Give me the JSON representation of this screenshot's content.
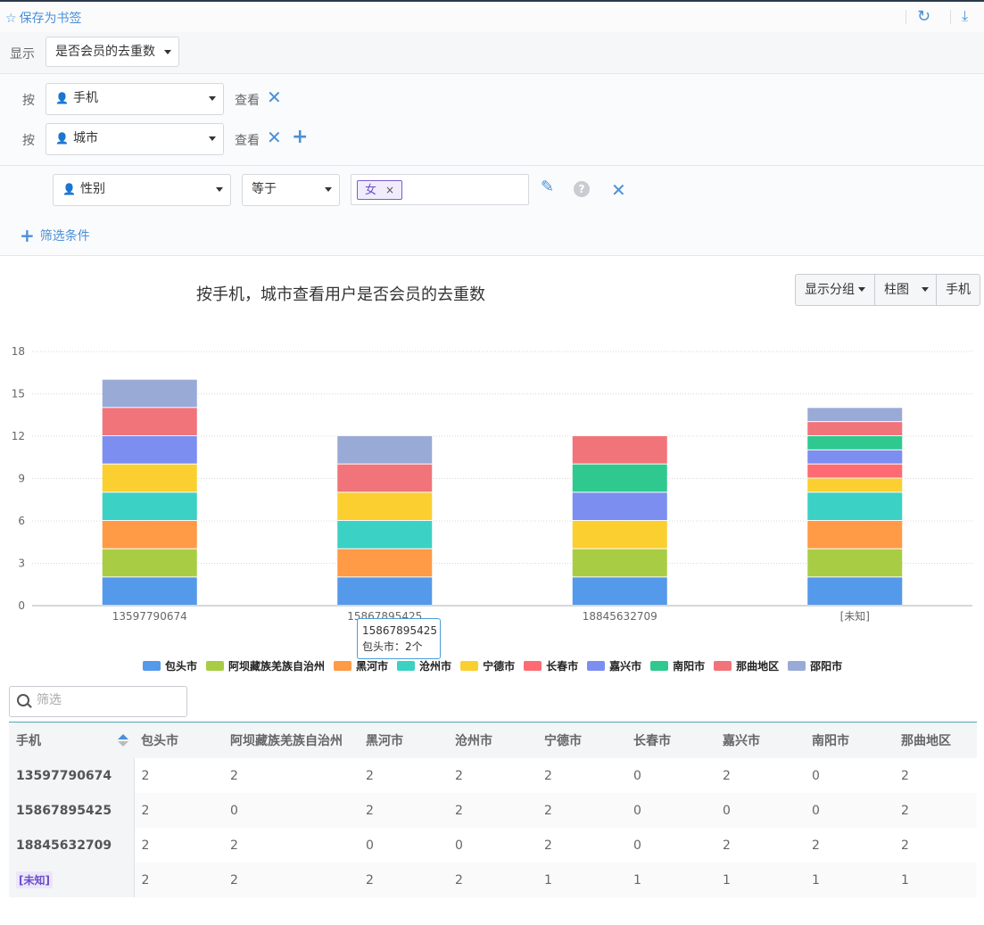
{
  "topbar": {
    "bookmark_label": "保存为书签",
    "star_icon": "star-outline-icon",
    "refresh_icon": "refresh-icon",
    "download_icon": "download-icon"
  },
  "show": {
    "label": "显示",
    "metric": "是否会员的去重数"
  },
  "groupby": {
    "by_label": "按",
    "view_label": "查看",
    "rows": [
      {
        "field": "手机"
      },
      {
        "field": "城市"
      }
    ]
  },
  "filter": {
    "field": "性别",
    "operator": "等于",
    "tag": "女",
    "tag_close": "×",
    "help": "?",
    "add_label": "筛选条件"
  },
  "chart_header": {
    "title": "按手机，城市查看用户是否会员的去重数",
    "buttons": [
      "显示分组",
      "柱图",
      "手机"
    ]
  },
  "tooltip": {
    "title": "15867895425",
    "line": "包头市：2个"
  },
  "chart_data": {
    "type": "bar",
    "stacked": true,
    "categories": [
      "13597790674",
      "15867895425",
      "18845632709",
      "[未知]"
    ],
    "ylim": [
      0,
      18
    ],
    "yticks": [
      0,
      3,
      6,
      9,
      12,
      15,
      18
    ],
    "grid": true,
    "legend": "bottom",
    "series": [
      {
        "name": "包头市",
        "color": "#5599ea",
        "values": [
          2,
          2,
          2,
          2
        ]
      },
      {
        "name": "阿坝藏族羌族自治州",
        "color": "#a8cd44",
        "values": [
          2,
          0,
          2,
          2
        ]
      },
      {
        "name": "黑河市",
        "color": "#ff9a46",
        "values": [
          2,
          2,
          0,
          2
        ]
      },
      {
        "name": "沧州市",
        "color": "#3bd1c4",
        "values": [
          2,
          2,
          0,
          2
        ]
      },
      {
        "name": "宁德市",
        "color": "#fbcf2f",
        "values": [
          2,
          2,
          2,
          1
        ]
      },
      {
        "name": "长春市",
        "color": "#ff6b72",
        "values": [
          0,
          0,
          0,
          1
        ]
      },
      {
        "name": "嘉兴市",
        "color": "#7c8ef0",
        "values": [
          2,
          0,
          2,
          1
        ]
      },
      {
        "name": "南阳市",
        "color": "#2fc990",
        "values": [
          0,
          0,
          2,
          1
        ]
      },
      {
        "name": "那曲地区",
        "color": "#f0747a",
        "values": [
          2,
          2,
          2,
          1
        ]
      },
      {
        "name": "邵阳市",
        "color": "#99aad6",
        "values": [
          2,
          2,
          0,
          1
        ]
      }
    ]
  },
  "table": {
    "search_placeholder": "筛选",
    "corner": "手机",
    "columns": [
      "包头市",
      "阿坝藏族羌族自治州",
      "黑河市",
      "沧州市",
      "宁德市",
      "长春市",
      "嘉兴市",
      "南阳市",
      "那曲地区"
    ],
    "rows": [
      {
        "label": "13597790674",
        "cells": [
          "2",
          "2",
          "2",
          "2",
          "2",
          "0",
          "2",
          "0",
          "2"
        ]
      },
      {
        "label": "15867895425",
        "cells": [
          "2",
          "0",
          "2",
          "2",
          "2",
          "0",
          "0",
          "0",
          "2"
        ]
      },
      {
        "label": "18845632709",
        "cells": [
          "2",
          "2",
          "0",
          "0",
          "2",
          "0",
          "2",
          "2",
          "2"
        ]
      },
      {
        "label": "[未知]",
        "cells": [
          "2",
          "2",
          "2",
          "2",
          "1",
          "1",
          "1",
          "1",
          "1"
        ]
      }
    ]
  }
}
